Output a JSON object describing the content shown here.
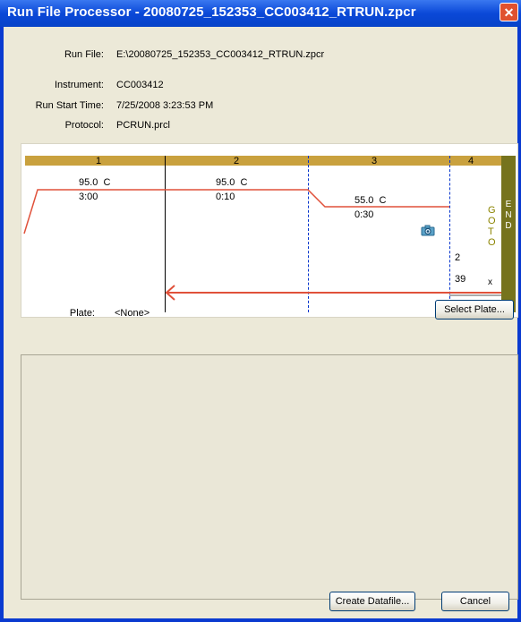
{
  "window": {
    "title": "Run File Processor - 20080725_152353_CC003412_RTRUN.zpcr",
    "close_glyph": "✕"
  },
  "info": {
    "run_file_label": "Run File:",
    "run_file_value": "E:\\20080725_152353_CC003412_RTRUN.zpcr",
    "instrument_label": "Instrument:",
    "instrument_value": "CC003412",
    "start_label": "Run Start Time:",
    "start_value": "7/25/2008 3:23:53 PM",
    "protocol_label": "Protocol:",
    "protocol_value": "PCRUN.prcl"
  },
  "protocol": {
    "steps": [
      {
        "number": "1",
        "temp": "95.0",
        "unit": "C",
        "time": "3:00"
      },
      {
        "number": "2",
        "temp": "95.0",
        "unit": "C",
        "time": "0:10"
      },
      {
        "number": "3",
        "temp": "55.0",
        "unit": "C",
        "time": "0:30"
      },
      {
        "number": "4"
      }
    ],
    "goto_letters": [
      "G",
      "O",
      "T",
      "O"
    ],
    "goto_step": "2",
    "goto_count": "39",
    "goto_x": "x",
    "end_letters": [
      "E",
      "N",
      "D"
    ],
    "camera_icon": "camera-icon",
    "line_color": "#e0513a",
    "header_color": "#c9a13e",
    "end_color": "#76731d"
  },
  "plate": {
    "label": "Plate:",
    "value": "<None>",
    "select_button": "Select Plate..."
  },
  "footer": {
    "create_button": "Create Datafile...",
    "cancel_button": "Cancel"
  }
}
